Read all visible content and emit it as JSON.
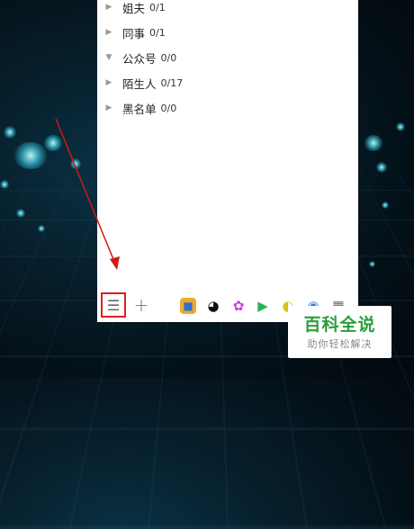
{
  "contact_groups": [
    {
      "name": "姐夫",
      "count": "0/1",
      "expanded": false
    },
    {
      "name": "同事",
      "count": "0/1",
      "expanded": false
    },
    {
      "name": "公众号",
      "count": "0/0",
      "expanded": true
    },
    {
      "name": "陌生人",
      "count": "0/17",
      "expanded": false
    },
    {
      "name": "黑名单",
      "count": "0/0",
      "expanded": false
    }
  ],
  "bottombar": {
    "menu_icon": "menu-icon",
    "add_icon": "plus-icon",
    "apps": [
      "game-app-icon",
      "penguin-app-icon",
      "flower-app-icon",
      "video-play-icon",
      "music-app-icon",
      "browser-app-icon",
      "grid-app-icon"
    ]
  },
  "watermark": {
    "title": "百科全说",
    "subtitle": "助你轻松解决"
  },
  "colors": {
    "highlight": "#e01f1f",
    "arrow": "#d01818",
    "brand_green": "#2a9d3c"
  }
}
